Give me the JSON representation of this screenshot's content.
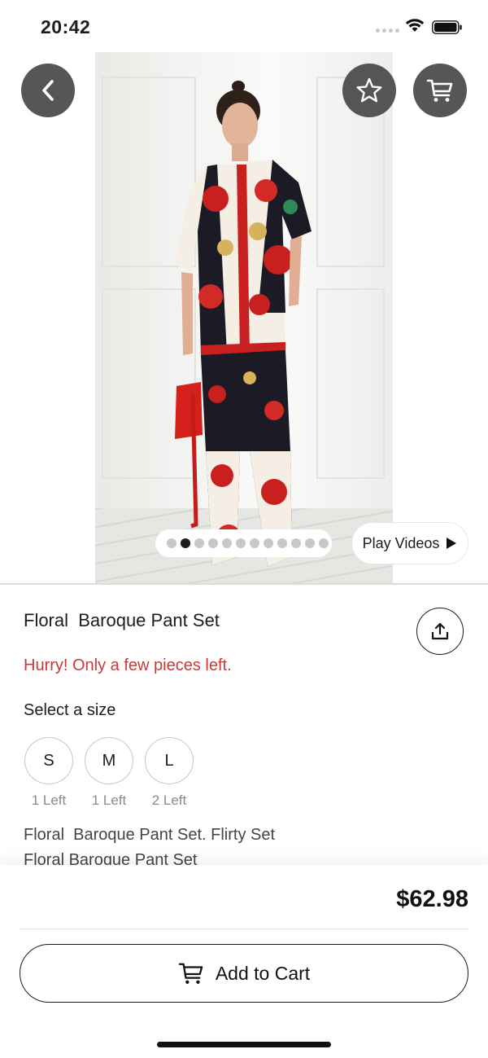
{
  "status_bar": {
    "time": "20:42"
  },
  "product": {
    "title": "Floral  Baroque Pant Set",
    "stock_warning": "Hurry! Only a few pieces left.",
    "size_prompt": "Select a size",
    "sizes": [
      {
        "label": "S",
        "stock": "1 Left"
      },
      {
        "label": "M",
        "stock": "1 Left"
      },
      {
        "label": "L",
        "stock": "2 Left"
      }
    ],
    "description_line1": "Floral  Baroque Pant Set. Flirty Set",
    "description_line2": "Floral Baroque Pant Set",
    "price": "$62.98"
  },
  "gallery": {
    "total_images": 12,
    "active_index": 1,
    "play_videos_label": "Play Videos"
  },
  "actions": {
    "add_to_cart_label": "Add to Cart"
  },
  "icons": {
    "back": "chevron-left-icon",
    "favorite": "star-icon",
    "cart": "cart-icon",
    "share": "share-icon",
    "play": "play-icon"
  },
  "colors": {
    "warning": "#c83a3a",
    "overlay_button": "#484848",
    "active_dot": "#1c1c1c"
  }
}
